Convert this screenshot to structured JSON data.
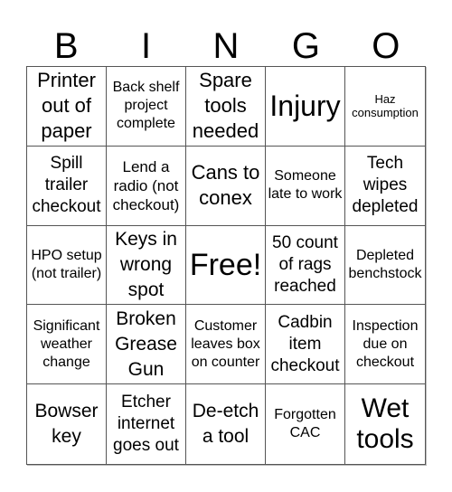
{
  "title_letters": [
    "B",
    "I",
    "N",
    "G",
    "O"
  ],
  "cells": [
    "Printer out of paper",
    "Back shelf project complete",
    "Spare tools needed",
    "Injury",
    "Haz consumption",
    "Spill trailer checkout",
    "Lend a radio (not checkout)",
    "Cans to conex",
    "Someone late to work",
    "Tech wipes depleted",
    "HPO setup (not trailer)",
    "Keys in wrong spot",
    "Free!",
    "50 count of rags reached",
    "Depleted benchstock",
    "Significant weather change",
    "Broken Grease Gun",
    "Customer leaves box on counter",
    "Cadbin item checkout",
    "Inspection due on checkout",
    "Bowser key",
    "Etcher internet goes out",
    "De-etch a tool",
    "Forgotten CAC",
    "Wet tools"
  ]
}
